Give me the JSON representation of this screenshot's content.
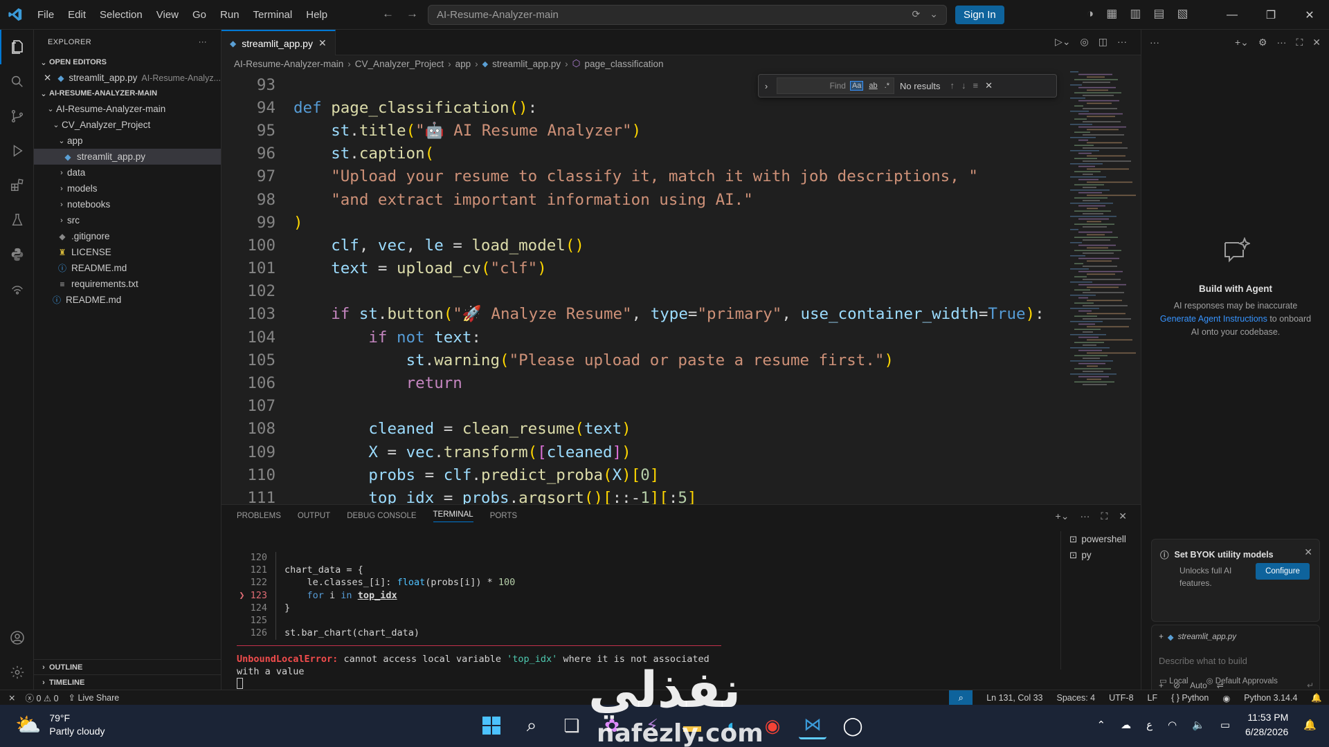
{
  "titlebar": {
    "menu": [
      "File",
      "Edit",
      "Selection",
      "View",
      "Go",
      "Run",
      "Terminal",
      "Help"
    ],
    "search_text": "AI-Resume-Analyzer-main",
    "signin_label": "Sign In"
  },
  "sidebar": {
    "title": "EXPLORER",
    "open_editors_label": "OPEN EDITORS",
    "open_editor": {
      "name": "streamlit_app.py",
      "path": "AI-Resume-Analyz..."
    },
    "project_label": "AI-RESUME-ANALYZER-MAIN",
    "tree": [
      {
        "name": "AI-Resume-Analyzer-main",
        "type": "folder",
        "open": true,
        "depth": 1
      },
      {
        "name": "CV_Analyzer_Project",
        "type": "folder",
        "open": true,
        "depth": 2
      },
      {
        "name": "app",
        "type": "folder",
        "open": true,
        "depth": 3
      },
      {
        "name": "streamlit_app.py",
        "type": "py",
        "depth": 4,
        "selected": true
      },
      {
        "name": "data",
        "type": "folder",
        "open": false,
        "depth": 3
      },
      {
        "name": "models",
        "type": "folder",
        "open": false,
        "depth": 3
      },
      {
        "name": "notebooks",
        "type": "folder",
        "open": false,
        "depth": 3
      },
      {
        "name": "src",
        "type": "folder",
        "open": false,
        "depth": 3
      },
      {
        "name": ".gitignore",
        "type": "git",
        "depth": 3
      },
      {
        "name": "LICENSE",
        "type": "license",
        "depth": 3
      },
      {
        "name": "README.md",
        "type": "md",
        "depth": 3
      },
      {
        "name": "requirements.txt",
        "type": "txt",
        "depth": 3
      },
      {
        "name": "README.md",
        "type": "md",
        "depth": 2
      }
    ],
    "outline_label": "OUTLINE",
    "timeline_label": "TIMELINE"
  },
  "editor": {
    "tab_label": "streamlit_app.py",
    "breadcrumb": [
      "AI-Resume-Analyzer-main",
      "CV_Analyzer_Project",
      "app",
      "streamlit_app.py",
      "page_classification"
    ],
    "find": {
      "placeholder": "Find",
      "opt_case": "Aa",
      "opt_word": "ab",
      "opt_regex": ".*",
      "result": "No results"
    },
    "lines": [
      {
        "n": "93",
        "html": ""
      },
      {
        "n": "94",
        "html": "<span class='kw'>def</span> <span class='fn'>page_classification</span><span class='paren'>()</span>:"
      },
      {
        "n": "95",
        "html": "    <span class='var'>st</span>.<span class='fn'>title</span><span class='paren'>(</span><span class='str'>\"🤖 AI Resume Analyzer\"</span><span class='paren'>)</span>"
      },
      {
        "n": "96",
        "html": "    <span class='var'>st</span>.<span class='fn'>caption</span><span class='paren'>(</span>"
      },
      {
        "n": "97",
        "html": "    <span class='str'>\"Upload your resume to classify it, match it with job descriptions, \"</span>"
      },
      {
        "n": "98",
        "html": "    <span class='str'>\"and extract important information using AI.\"</span>"
      },
      {
        "n": "99",
        "html": "<span class='paren'>)</span>"
      },
      {
        "n": "100",
        "html": "    <span class='var'>clf</span>, <span class='var'>vec</span>, <span class='var'>le</span> = <span class='fn'>load_model</span><span class='paren'>()</span>"
      },
      {
        "n": "101",
        "html": "    <span class='var'>text</span> = <span class='fn'>upload_cv</span><span class='paren'>(</span><span class='str'>\"clf\"</span><span class='paren'>)</span>"
      },
      {
        "n": "102",
        "html": ""
      },
      {
        "n": "103",
        "html": "    <span class='kw2'>if</span> <span class='var'>st</span>.<span class='fn'>button</span><span class='paren'>(</span><span class='str'>\"🚀 Analyze Resume\"</span>, <span class='var'>type</span>=<span class='str'>\"primary\"</span>, <span class='var'>use_container_width</span>=<span class='bool'>True</span><span class='paren'>)</span>:"
      },
      {
        "n": "104",
        "html": "        <span class='kw2'>if</span> <span class='kw'>not</span> <span class='var'>text</span>:"
      },
      {
        "n": "105",
        "html": "            <span class='var'>st</span>.<span class='fn'>warning</span><span class='paren'>(</span><span class='str'>\"Please upload or paste a resume first.\"</span><span class='paren'>)</span>"
      },
      {
        "n": "106",
        "html": "            <span class='kw2'>return</span>"
      },
      {
        "n": "107",
        "html": ""
      },
      {
        "n": "108",
        "html": "        <span class='var'>cleaned</span> = <span class='fn'>clean_resume</span><span class='paren'>(</span><span class='var'>text</span><span class='paren'>)</span>"
      },
      {
        "n": "109",
        "html": "        <span class='var'>X</span> = <span class='var'>vec</span>.<span class='fn'>transform</span><span class='paren'>(</span><span class='paren2'>[</span><span class='var'>cleaned</span><span class='paren2'>]</span><span class='paren'>)</span>"
      },
      {
        "n": "110",
        "html": "        <span class='var'>probs</span> = <span class='var'>clf</span>.<span class='fn'>predict_proba</span><span class='paren'>(</span><span class='var'>X</span><span class='paren'>)</span><span class='paren'>[</span><span class='num'>0</span><span class='paren'>]</span>"
      },
      {
        "n": "111",
        "html": "        <span class='var'>top_idx</span> = <span class='var'>probs</span>.<span class='fn'>argsort</span><span class='paren'>()</span><span class='paren'>[</span>::-<span class='num'>1</span><span class='paren'>]</span><span class='paren'>[</span>:<span class='num'>5</span><span class='paren'>]</span>"
      }
    ]
  },
  "panel": {
    "tabs": [
      "PROBLEMS",
      "OUTPUT",
      "DEBUG CONSOLE",
      "TERMINAL",
      "PORTS"
    ],
    "active_tab": "TERMINAL",
    "terminal_lines": [
      {
        "n": "120",
        "err": false,
        "html": ""
      },
      {
        "n": "121",
        "err": false,
        "html": "chart_data = {"
      },
      {
        "n": "122",
        "err": false,
        "html": "    le.classes_[i]: <span class='fn'>float</span>(probs[i]) * <span class='num'>100</span>"
      },
      {
        "n": "123",
        "err": true,
        "html": "    <span class='kw'>for</span> i <span class='kw'>in</span> <span class='ul'>top_idx</span>"
      },
      {
        "n": "124",
        "err": false,
        "html": "}"
      },
      {
        "n": "125",
        "err": false,
        "html": ""
      },
      {
        "n": "126",
        "err": false,
        "html": "st.bar_chart(chart_data)"
      }
    ],
    "error_type": "UnboundLocalError:",
    "error_msg_1": " cannot access local variable ",
    "error_var": "'top_idx'",
    "error_msg_2": " where it is not associated",
    "error_msg_3": "with a value",
    "terminals": [
      "powershell",
      "py"
    ]
  },
  "chat": {
    "agent_title": "Build with Agent",
    "agent_desc_1": "AI responses may be inaccurate",
    "agent_link": "Generate Agent Instructions",
    "agent_desc_2": " to onboard AI onto your codebase.",
    "byok_title": "Set BYOK utility models",
    "byok_desc": "Unlocks full AI features.",
    "byok_button": "Configure",
    "context_file": "streamlit_app.py",
    "input_placeholder": "Describe what to build",
    "mode": "Auto",
    "footer_local": "Local",
    "footer_approvals": "Default Approvals"
  },
  "status": {
    "errors": "0",
    "warnings": "0",
    "live_share": "Live Share",
    "position": "Ln 131, Col 33",
    "spaces": "Spaces: 4",
    "encoding": "UTF-8",
    "eol": "LF",
    "language": "Python",
    "interpreter": "Python 3.14.4"
  },
  "taskbar": {
    "temp": "79°F",
    "weather": "Partly cloudy",
    "time": "11:53 PM",
    "date": "6/28/2026",
    "lang": "ع"
  },
  "watermark": {
    "arabic": "نفذلي",
    "latin": "nafezly.com"
  }
}
